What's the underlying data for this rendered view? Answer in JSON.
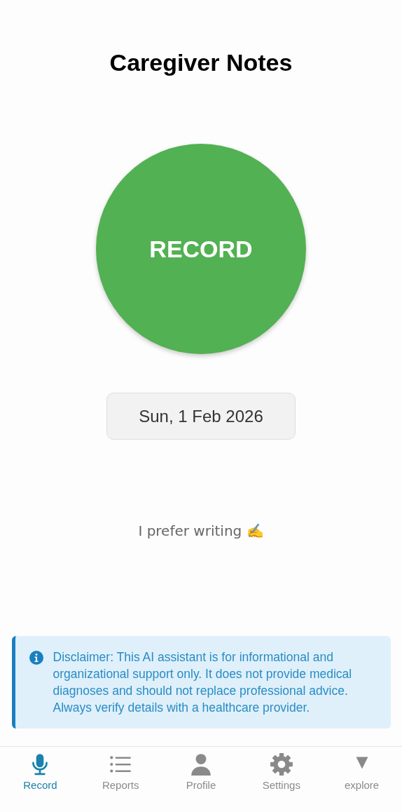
{
  "title": "Caregiver Notes",
  "record_button": {
    "label": "RECORD"
  },
  "date_button": {
    "label": "Sun, 1 Feb 2026"
  },
  "writing_link": {
    "label": "I prefer writing ✍️"
  },
  "disclaimer": {
    "text": "Disclaimer: This AI assistant is for informational and organizational support only. It does not provide medical diagnoses and should not replace professional advice. Always verify details with a healthcare provider."
  },
  "tabs": [
    {
      "label": "Record",
      "kind": "mic",
      "selected": true
    },
    {
      "label": "Reports",
      "kind": "list",
      "selected": false
    },
    {
      "label": "Profile",
      "kind": "person",
      "selected": false
    },
    {
      "label": "Settings",
      "kind": "gear",
      "selected": false
    },
    {
      "label": "explore",
      "kind": "triangle",
      "selected": false
    }
  ]
}
